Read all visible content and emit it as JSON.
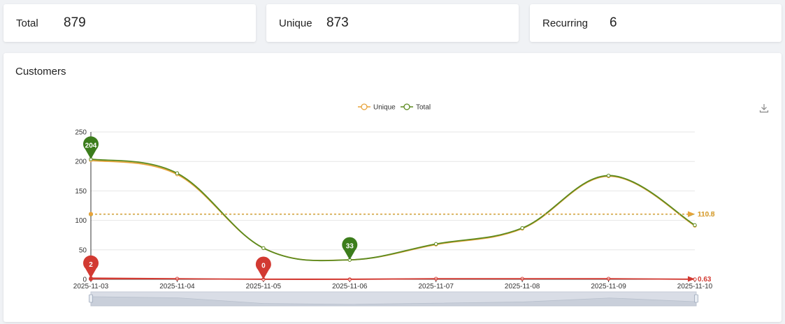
{
  "stats": [
    {
      "label": "Total",
      "value": "879"
    },
    {
      "label": "Unique",
      "value": "873"
    },
    {
      "label": "Recurring",
      "value": "6"
    }
  ],
  "panel": {
    "title": "Customers",
    "download_icon": "download-icon"
  },
  "colors": {
    "unique": "#e8a33a",
    "total": "#5b8a1e",
    "recurring": "#d23a32",
    "pin_total": "#3c7d1c"
  },
  "chart_data": {
    "type": "line",
    "title": "",
    "xlabel": "",
    "ylabel": "",
    "ylim": [
      0,
      250
    ],
    "yticks": [
      "0",
      "50",
      "100",
      "150",
      "200",
      "250"
    ],
    "categories": [
      "2025-11-03",
      "2025-11-04",
      "2025-11-05",
      "2025-11-06",
      "2025-11-07",
      "2025-11-08",
      "2025-11-09",
      "2025-11-10"
    ],
    "legend": [
      "Unique",
      "Total"
    ],
    "legend_position": "top-center",
    "grid": true,
    "series": [
      {
        "name": "Unique",
        "values": [
          202,
          178,
          53,
          33,
          59,
          86,
          175,
          91
        ]
      },
      {
        "name": "Total",
        "values": [
          204,
          180,
          53,
          33,
          60,
          87,
          176,
          92
        ]
      },
      {
        "name": "",
        "values": [
          2,
          1,
          0,
          0,
          1,
          1,
          1,
          0
        ]
      }
    ],
    "markpoints": [
      {
        "series": "Total",
        "label": "204",
        "category": "2025-11-03",
        "value": 204
      },
      {
        "series": "Total",
        "label": "33",
        "category": "2025-11-06",
        "value": 33
      },
      {
        "series": "",
        "label": "2",
        "category": "2025-11-03",
        "value": 2
      },
      {
        "series": "",
        "label": "0",
        "category": "2025-11-05",
        "value": 0
      }
    ],
    "marklines": [
      {
        "series": "Total",
        "label": "110.5",
        "value": 110.5
      },
      {
        "series": "Unique",
        "label": "110.8",
        "value": 110.8
      },
      {
        "series": "",
        "label": "0.63",
        "value": 0.63
      }
    ],
    "datazoom": {
      "start": 0,
      "end": 100
    }
  }
}
